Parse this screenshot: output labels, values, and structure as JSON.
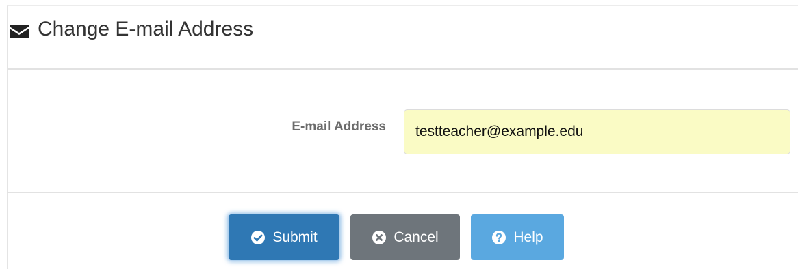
{
  "header": {
    "icon": "envelope-icon",
    "title": "Change E-mail Address"
  },
  "form": {
    "email_label": "E-mail Address",
    "email_value": "testteacher@example.edu",
    "input_background": "#fafbc5"
  },
  "buttons": {
    "submit": {
      "label": "Submit",
      "icon": "check-circle-icon",
      "color": "#2f78b4"
    },
    "cancel": {
      "label": "Cancel",
      "icon": "times-circle-icon",
      "color": "#6e757b"
    },
    "help": {
      "label": "Help",
      "icon": "question-circle-icon",
      "color": "#5aa8e0"
    }
  }
}
